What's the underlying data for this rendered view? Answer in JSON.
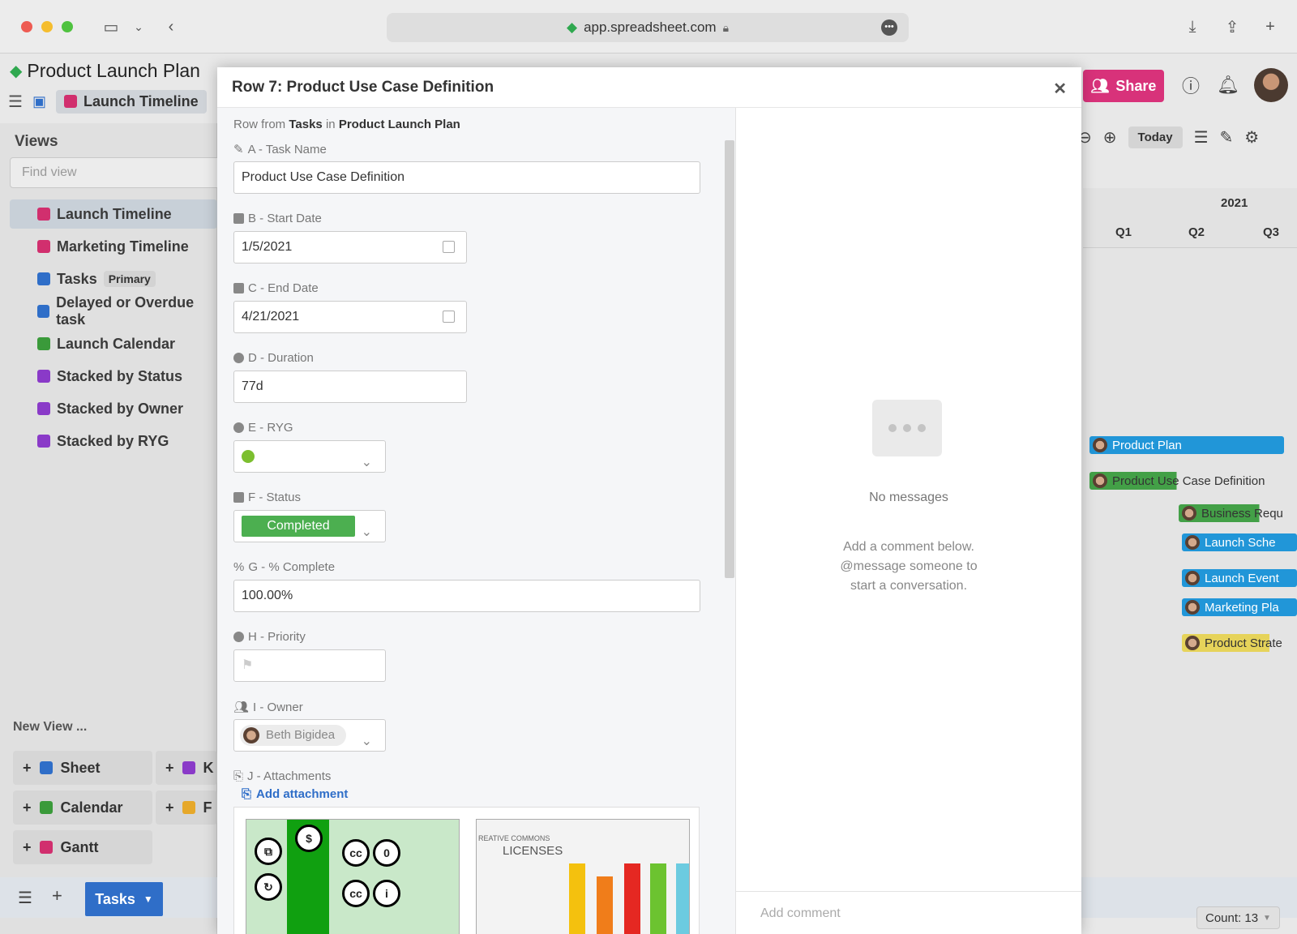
{
  "browser": {
    "url": "app.spreadsheet.com"
  },
  "app": {
    "title": "Product Launch Plan",
    "current_view": "Launch Timeline",
    "share_label": "Share"
  },
  "sidebar": {
    "heading": "Views",
    "find_placeholder": "Find view",
    "items": [
      {
        "label": "Launch Timeline",
        "color": "#d12f6e",
        "active": true
      },
      {
        "label": "Marketing Timeline",
        "color": "#d12f6e"
      },
      {
        "label": "Tasks",
        "badge": "Primary",
        "color": "#2f6ec8"
      },
      {
        "label": "Delayed or Overdue task",
        "color": "#2f6ec8"
      },
      {
        "label": "Launch Calendar",
        "color": "#3a9a3a"
      },
      {
        "label": "Stacked by Status",
        "color": "#8a3ac8"
      },
      {
        "label": "Stacked by Owner",
        "color": "#8a3ac8"
      },
      {
        "label": "Stacked by RYG",
        "color": "#8a3ac8"
      }
    ],
    "new_view_label": "New View ...",
    "new_view_buttons": [
      "Sheet",
      "K",
      "Calendar",
      "F",
      "Gantt"
    ]
  },
  "bottom": {
    "tab_label": "Tasks",
    "count_label": "Count: 13"
  },
  "gantt": {
    "today_label": "Today",
    "year": "2021",
    "quarters": [
      "Q1",
      "Q2",
      "Q3"
    ],
    "bars": [
      {
        "label": "Product Plan",
        "color": "#2196d8"
      },
      {
        "label": "Product Use Case Definition",
        "color": "#43a047"
      },
      {
        "label": "Business Requ",
        "color": "#43a047"
      },
      {
        "label": "Launch Sche",
        "color": "#2196d8"
      },
      {
        "label": "Launch Event",
        "color": "#2196d8"
      },
      {
        "label": "Marketing Pla",
        "color": "#2196d8"
      },
      {
        "label": "Product Strate",
        "color": "#e6d35a"
      }
    ]
  },
  "modal": {
    "title": "Row 7: Product Use Case Definition",
    "row_from_prefix": "Row from",
    "row_from_sheet": "Tasks",
    "row_from_in": "in",
    "row_from_doc": "Product Launch Plan",
    "fields": {
      "task_name": {
        "label": "A - Task Name",
        "value": "Product Use Case Definition"
      },
      "start_date": {
        "label": "B - Start Date",
        "value": "1/5/2021"
      },
      "end_date": {
        "label": "C - End Date",
        "value": "4/21/2021"
      },
      "duration": {
        "label": "D - Duration",
        "value": "77d"
      },
      "ryg": {
        "label": "E - RYG",
        "color": "#7cbf2f"
      },
      "status": {
        "label": "F - Status",
        "value": "Completed"
      },
      "complete": {
        "label": "G - % Complete",
        "value": "100.00%"
      },
      "priority": {
        "label": "H - Priority"
      },
      "owner": {
        "label": "I - Owner",
        "value": "Beth Bigidea"
      },
      "attachments": {
        "label": "J - Attachments",
        "add_label": "Add attachment"
      }
    },
    "thumb_lic_title_1": "REATIVE COMMONS",
    "thumb_lic_title_2": "LICENSES",
    "messages": {
      "empty": "No messages",
      "hint_1": "Add a comment below.",
      "hint_2": "@message someone to",
      "hint_3": "start a conversation.",
      "placeholder": "Add comment"
    }
  }
}
